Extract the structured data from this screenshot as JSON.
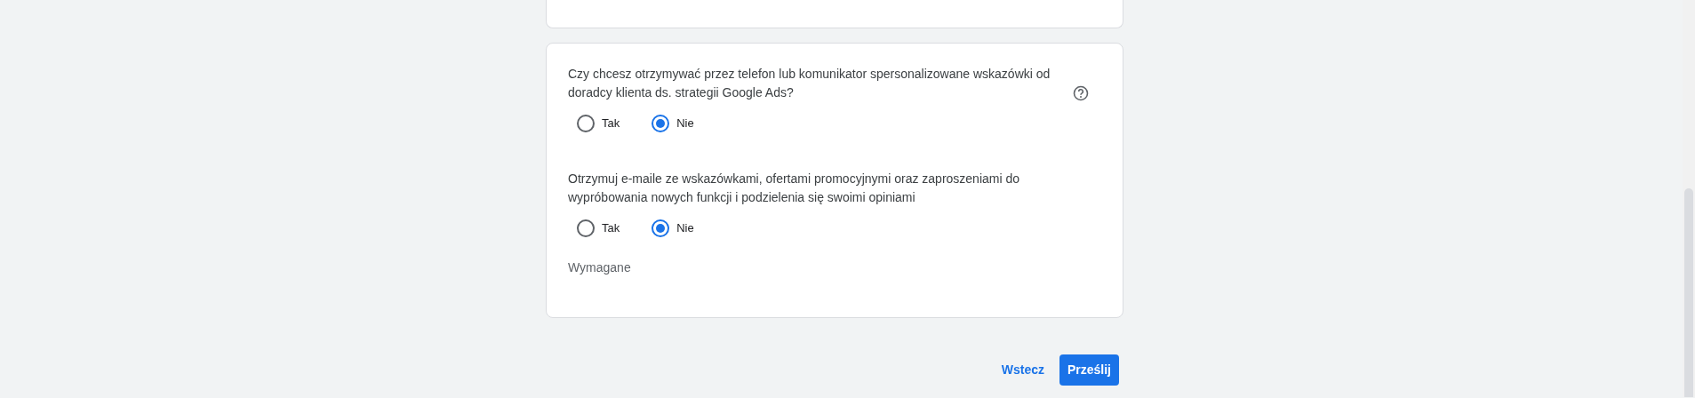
{
  "questions": [
    {
      "text": "Czy chcesz otrzymywać przez telefon lub komunikator spersonalizowane wskazówki od doradcy klienta ds. strategii Google Ads?",
      "help": true,
      "options": [
        {
          "label": "Tak",
          "selected": false
        },
        {
          "label": "Nie",
          "selected": true
        }
      ]
    },
    {
      "text": "Otrzymuj e-maile ze wskazówkami, ofertami promocyjnymi oraz zaproszeniami do wypróbowania nowych funkcji i podzielenia się swoimi opiniami",
      "help": false,
      "options": [
        {
          "label": "Tak",
          "selected": false
        },
        {
          "label": "Nie",
          "selected": true
        }
      ]
    }
  ],
  "required_note": "Wymagane",
  "buttons": [
    {
      "label": "Wstecz",
      "kind": "text"
    },
    {
      "label": "Prześlij",
      "kind": "primary"
    }
  ]
}
